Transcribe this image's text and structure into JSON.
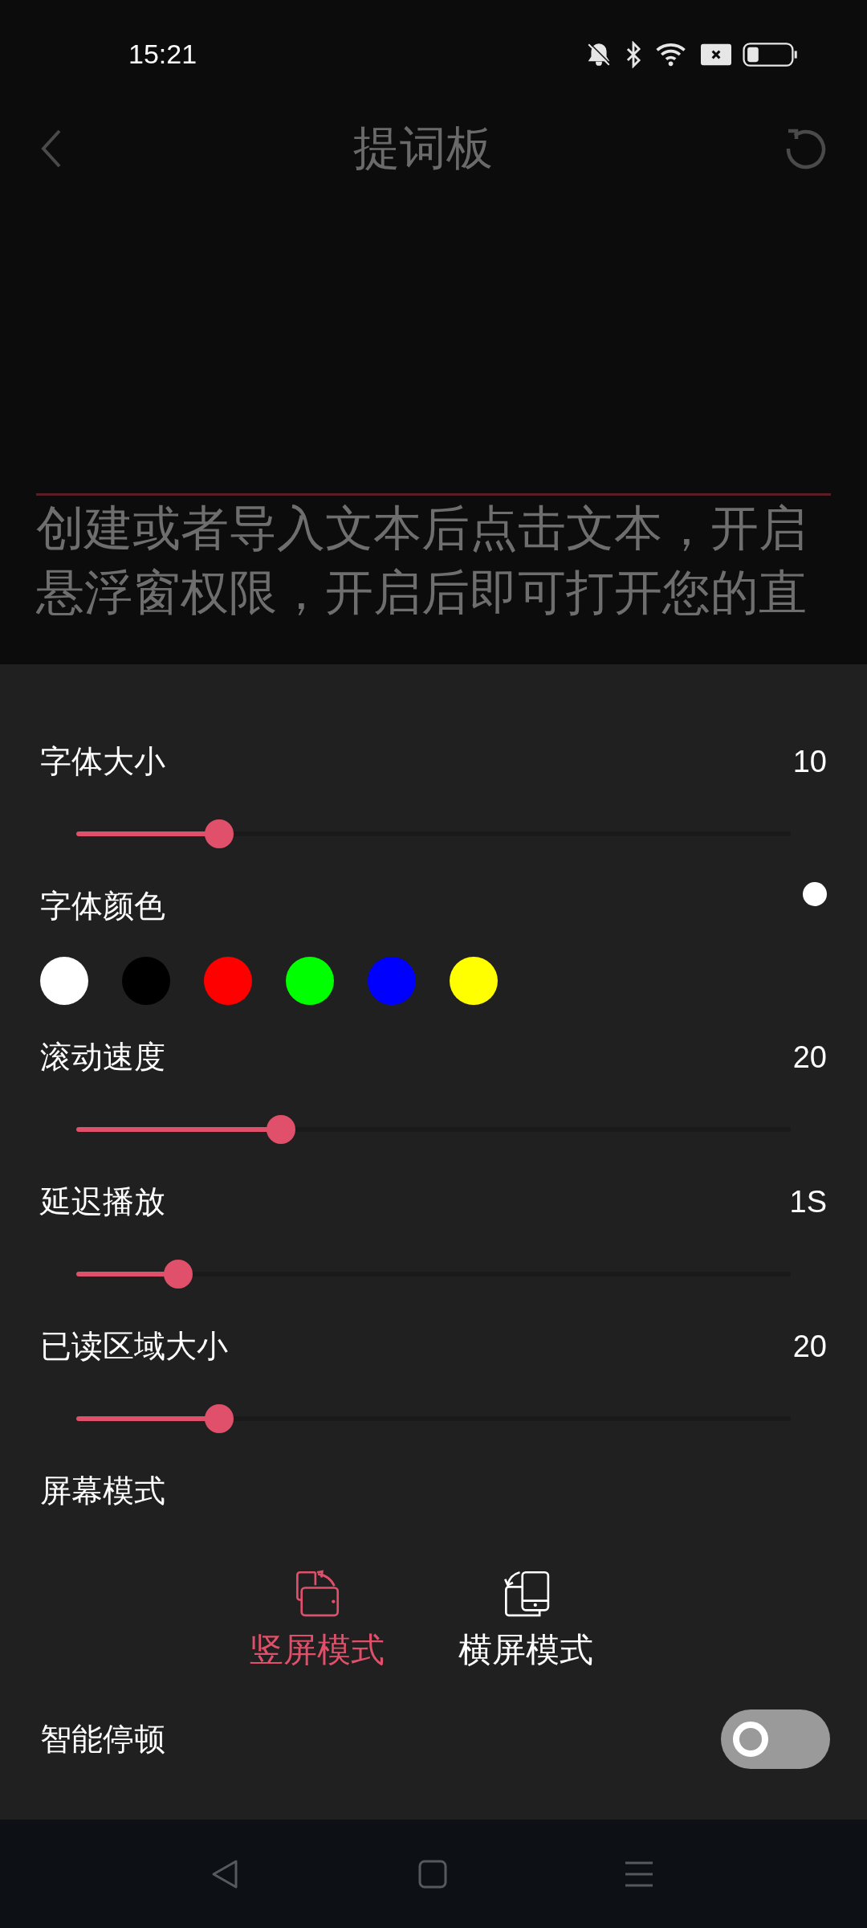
{
  "status_bar": {
    "time": "15:21"
  },
  "header": {
    "title": "提词板"
  },
  "editor": {
    "text": "创建或者导入文本后点击文本，开启悬浮窗权限，开启后即可打开您的直"
  },
  "settings": [
    {
      "kind": "slider",
      "label": "字体大小",
      "value": "10",
      "level": 0.2
    },
    {
      "kind": "colors",
      "label": "字体颜色",
      "current": {
        "color": "#ffffff"
      },
      "swatches": [
        {
          "color": "#ffffff"
        },
        {
          "color": "#000000"
        },
        {
          "color": "#ff0000"
        },
        {
          "color": "#00ff00"
        },
        {
          "color": "#0000ff"
        },
        {
          "color": "#ffff00"
        }
      ]
    },
    {
      "kind": "slider",
      "label": "滚动速度",
      "value": "20",
      "level": 0.287
    },
    {
      "kind": "slider",
      "label": "延迟播放",
      "value": "1S",
      "level": 0.143
    },
    {
      "kind": "slider",
      "label": "已读区域大小",
      "value": "20",
      "level": 0.2
    },
    {
      "kind": "modes",
      "label": "屏幕模式",
      "options": [
        {
          "label": "竖屏模式",
          "selected": true
        },
        {
          "label": "横屏模式",
          "selected": false
        }
      ]
    },
    {
      "kind": "toggle",
      "label": "智能停顿",
      "on": false
    }
  ]
}
